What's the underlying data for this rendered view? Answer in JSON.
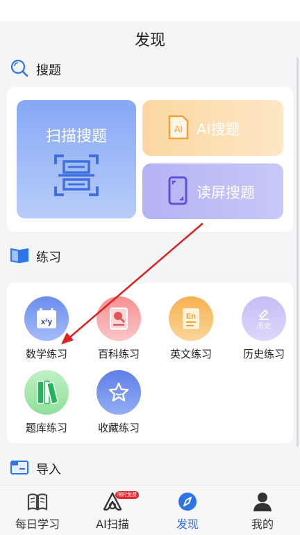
{
  "header": {
    "title": "发现"
  },
  "search_section": {
    "title": "搜题",
    "scan": {
      "label": "扫描搜题"
    },
    "ai": {
      "label": "AI搜题",
      "icon_text": "AI"
    },
    "read_screen": {
      "label": "读屏搜题"
    }
  },
  "practice_section": {
    "title": "练习",
    "items": [
      {
        "label": "数学练习",
        "icon": "math-icon",
        "icon_text": "x²y"
      },
      {
        "label": "百科练习",
        "icon": "encyclopedia-icon"
      },
      {
        "label": "英文练习",
        "icon": "english-icon",
        "icon_text": "En"
      },
      {
        "label": "历史练习",
        "icon": "history-icon",
        "icon_text": "历史"
      },
      {
        "label": "题库练习",
        "icon": "question-bank-icon"
      },
      {
        "label": "收藏练习",
        "icon": "favorites-icon"
      }
    ]
  },
  "import_section": {
    "title": "导入"
  },
  "tabs": [
    {
      "label": "每日学习",
      "icon": "book-icon",
      "active": false
    },
    {
      "label": "AI扫描",
      "icon": "ai-scan-icon",
      "badge": "限时免费",
      "active": false
    },
    {
      "label": "发现",
      "icon": "compass-icon",
      "active": true
    },
    {
      "label": "我的",
      "icon": "person-icon",
      "active": false
    }
  ],
  "colors": {
    "accent": "#2d74e6",
    "annotation_arrow": "#e0201f"
  }
}
